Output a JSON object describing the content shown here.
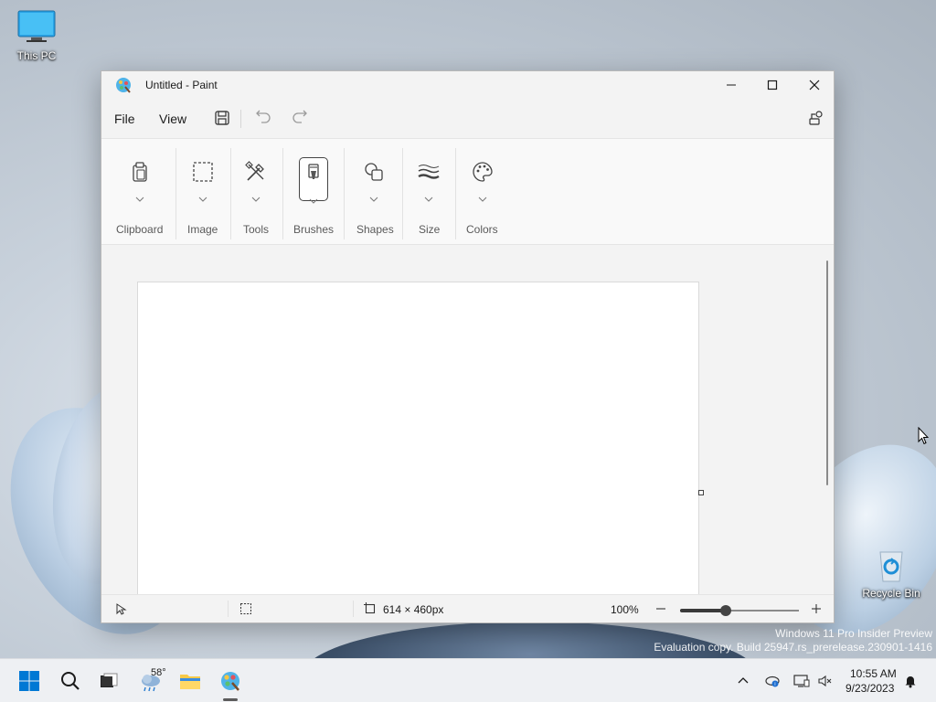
{
  "desktop": {
    "icons": [
      {
        "label": "This PC"
      },
      {
        "label": "Recycle Bin"
      }
    ],
    "watermark": {
      "line1": "Windows 11 Pro Insider Preview",
      "line2": "Evaluation copy. Build 25947.rs_prerelease.230901-1416"
    }
  },
  "window": {
    "title": "Untitled - Paint",
    "controls": [
      "minimize",
      "maximize",
      "close"
    ]
  },
  "menubar": {
    "file": "File",
    "view": "View",
    "icons": [
      "save-icon",
      "undo-icon",
      "redo-icon",
      "share-icon"
    ]
  },
  "ribbon": {
    "groups": [
      {
        "label": "Clipboard",
        "icon": "clipboard-icon"
      },
      {
        "label": "Image",
        "icon": "selection-icon"
      },
      {
        "label": "Tools",
        "icon": "tools-icon"
      },
      {
        "label": "Brushes",
        "icon": "brush-icon",
        "selected": true
      },
      {
        "label": "Shapes",
        "icon": "shapes-icon"
      },
      {
        "label": "Size",
        "icon": "size-icon"
      },
      {
        "label": "Colors",
        "icon": "palette-icon"
      }
    ]
  },
  "statusbar": {
    "canvas_size": "614 × 460px",
    "zoom": "100%",
    "zoom_fraction": 0.38
  },
  "taskbar": {
    "weather_temp": "58°",
    "time": "10:55 AM",
    "date": "9/23/2023"
  },
  "colors": {
    "accent": "#0067c0",
    "window_bg": "#f3f3f3",
    "canvas": "#ffffff",
    "taskbar": "#eef0f3"
  }
}
